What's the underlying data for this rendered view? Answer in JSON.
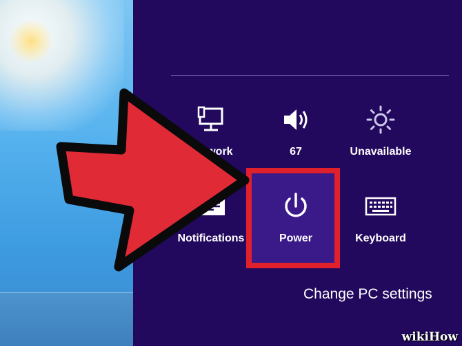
{
  "settings": {
    "tiles": [
      {
        "label": "Network",
        "icon": "network-icon"
      },
      {
        "label": "67",
        "icon": "volume-icon"
      },
      {
        "label": "Unavailable",
        "icon": "brightness-icon"
      },
      {
        "label": "Notifications",
        "icon": "notifications-icon"
      },
      {
        "label": "Power",
        "icon": "power-icon"
      },
      {
        "label": "Keyboard",
        "icon": "keyboard-icon"
      }
    ],
    "change_pc_settings": "Change PC settings"
  },
  "watermark": "wikiHow",
  "colors": {
    "panel_background": "#22095e",
    "highlight_border": "#e0202a",
    "arrow": "#e02a36"
  }
}
